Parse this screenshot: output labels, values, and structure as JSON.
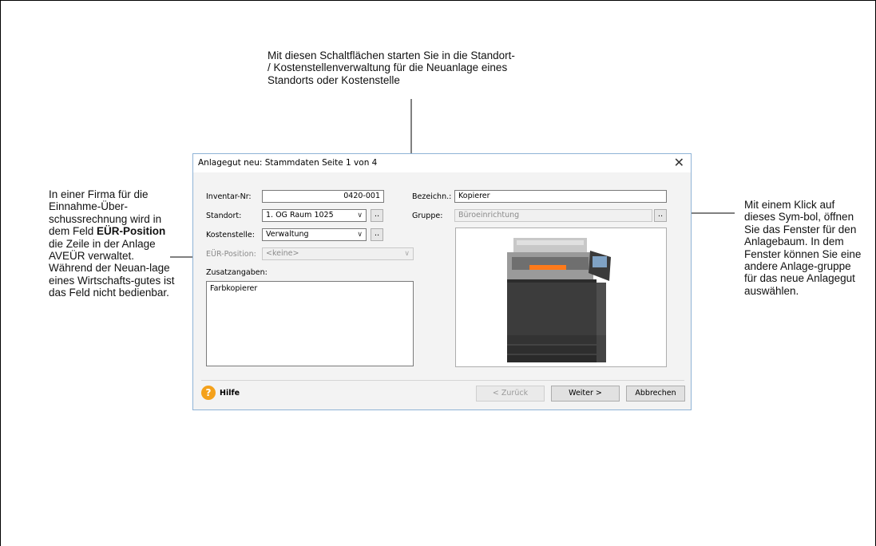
{
  "annotations": {
    "top": [
      "Mit diesen Schaltflächen starten Sie in die Standort-",
      "/ Kostenstellenverwaltung für die Neuanlage eines",
      "Standorts oder Kostenstelle"
    ],
    "left": {
      "p1": "In einer Firma für die Einnahme-Über-schussrechnung wird in dem Feld ",
      "bold": "EÜR-Position",
      "p2": " die Zeile in der Anlage AVEÜR verwaltet.",
      "p3": "Während der Neuan-lage eines Wirtschafts-gutes ist das Feld nicht bedienbar."
    },
    "right": "Mit einem Klick auf dieses Sym-bol, öffnen Sie das Fenster für den Anlagebaum. In dem Fenster können Sie eine andere Anlage-gruppe für das neue Anlagegut auswählen."
  },
  "dialog": {
    "title": "Anlagegut neu: Stammdaten Seite 1 von 4",
    "close": "✕",
    "inventar": {
      "label": "Inventar-Nr:",
      "value": "0420-001"
    },
    "standort": {
      "label": "Standort:",
      "value": "1. OG Raum 1025"
    },
    "kostenstelle": {
      "label": "Kostenstelle:",
      "value": "Verwaltung"
    },
    "eur_position": {
      "label": "EÜR-Position:",
      "value": "<keine>"
    },
    "zusatzangaben": {
      "label": "Zusatzangaben:",
      "value": "Farbkopierer"
    },
    "bezeichnung": {
      "label": "Bezeichn.:",
      "value": "Kopierer"
    },
    "gruppe": {
      "label": "Gruppe:",
      "value": "Büroeinrichtung"
    },
    "dots": "..",
    "arrow": "∨",
    "help": {
      "icon": "?",
      "label": "Hilfe"
    },
    "buttons": {
      "back": "< Zurück",
      "next": "Weiter >",
      "cancel": "Abbrechen"
    }
  },
  "icons": [
    "help-icon",
    "close-icon",
    "chevron-down-icon",
    "copier-image"
  ]
}
